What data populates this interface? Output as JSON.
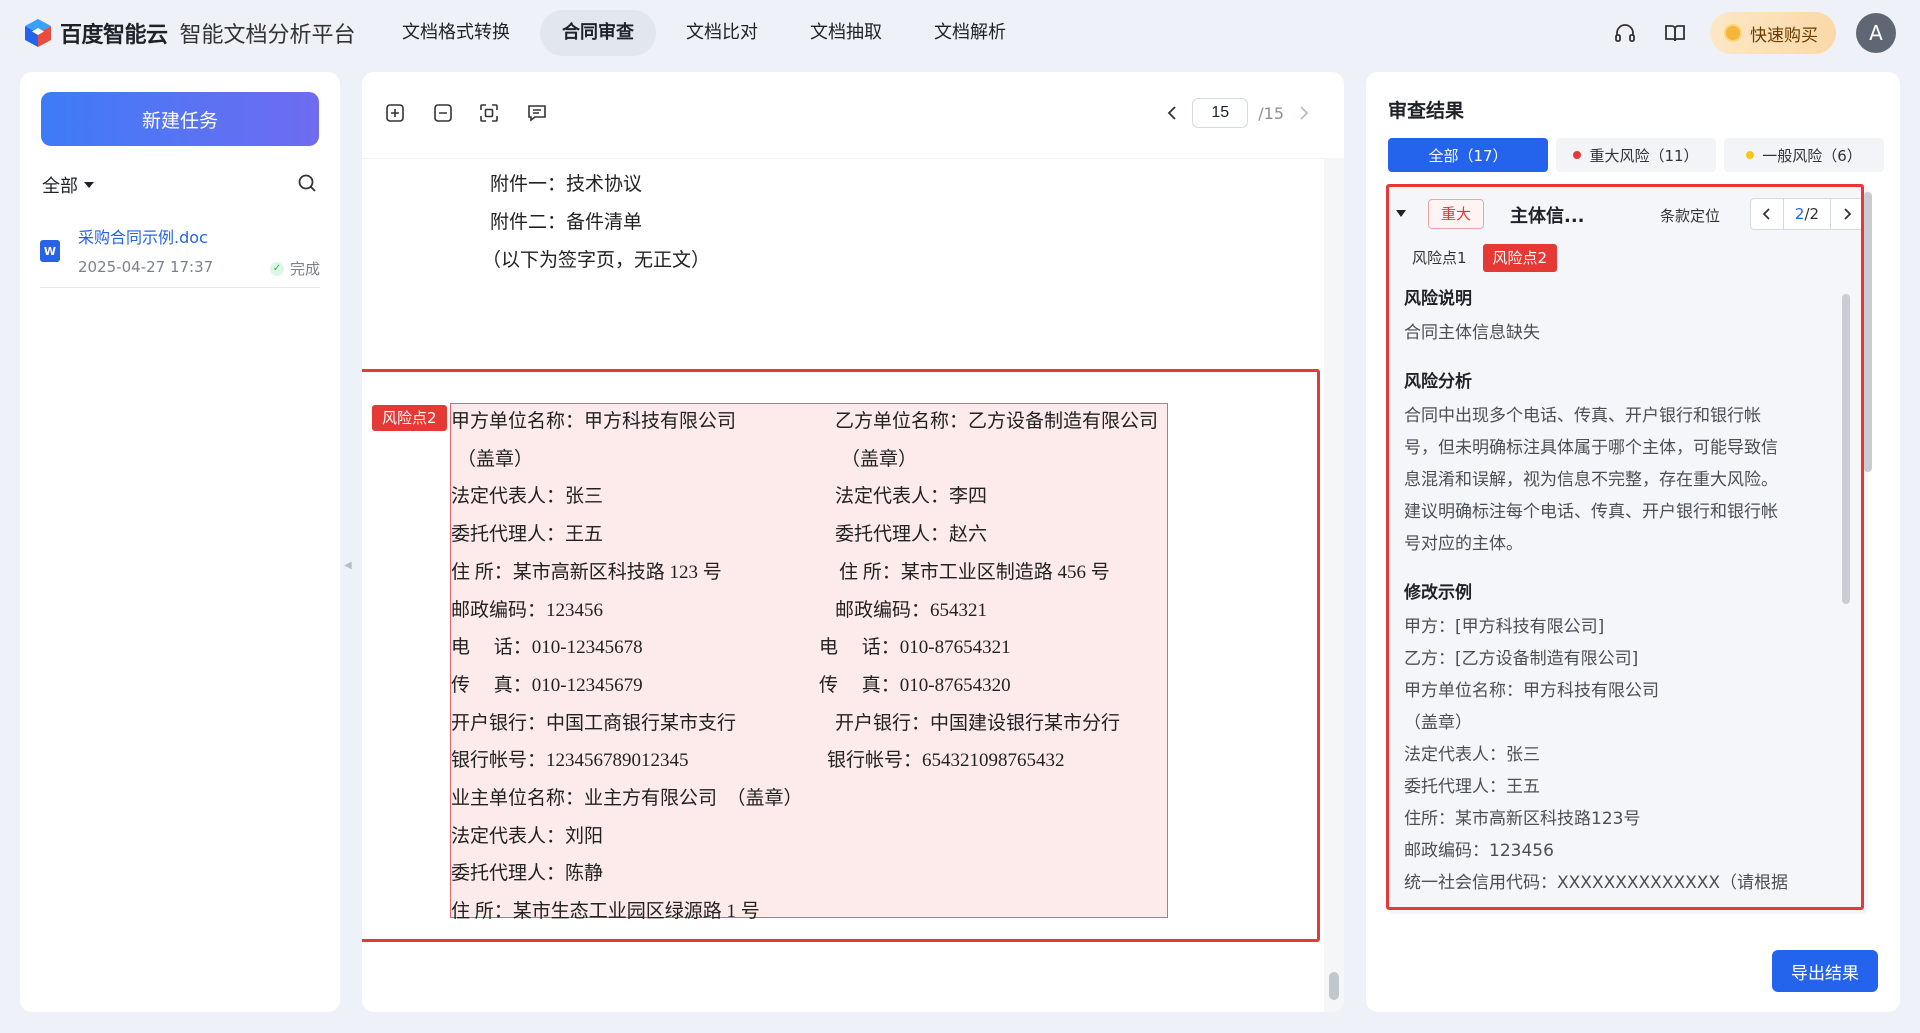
{
  "brand": {
    "company": "百度智能云",
    "product": "智能文档分析平台"
  },
  "nav": [
    {
      "label": "文档格式转换"
    },
    {
      "label": "合同审查"
    },
    {
      "label": "文档比对"
    },
    {
      "label": "文档抽取"
    },
    {
      "label": "文档解析"
    }
  ],
  "topbar": {
    "buy_label": "快速购买",
    "avatar_letter": "A"
  },
  "sidebar": {
    "new_task": "新建任务",
    "filter": "全部",
    "documents": [
      {
        "icon_letter": "W",
        "name": "采购合同示例.doc",
        "date": "2025-04-27 17:37",
        "status": "完成"
      }
    ]
  },
  "viewer": {
    "current_page": "15",
    "total_pages": "/15",
    "lines_before": [
      "附件一：技术协议",
      "附件二：备件清单",
      "（以下为签字页，无正文）"
    ],
    "risk_tag": "风险点2",
    "signature": {
      "left": [
        "甲方单位名称：甲方科技有限公司",
        "（盖章）",
        "法定代表人：张三",
        "委托代理人：王五",
        "住 所：某市高新区科技路 123 号",
        "邮政编码：123456",
        "电　 话：010-12345678",
        "传　 真：010-12345679",
        "开户银行：中国工商银行某市支行",
        "银行帐号：123456789012345",
        "业主单位名称：业主方有限公司　（盖章）",
        "法定代表人：刘阳",
        "委托代理人：陈静",
        "住 所：某市生态工业园区绿源路 1 号"
      ],
      "right": [
        "乙方单位名称：乙方设备制造有限公司",
        "（盖章）",
        "法定代表人：李四",
        "委托代理人：赵六",
        "住 所：某市工业区制造路 456 号",
        "邮政编码：654321",
        "电　 话：010-87654321",
        "传　 真：010-87654320",
        "开户银行：中国建设银行某市分行",
        "银行帐号：654321098765432"
      ]
    }
  },
  "results": {
    "title": "审查结果",
    "tabs": [
      {
        "label": "全部（17）",
        "dot": ""
      },
      {
        "label": "重大风险（11）",
        "dot": "#e53935"
      },
      {
        "label": "一般风险（6）",
        "dot": "#f5c518"
      }
    ],
    "card": {
      "severity": "重大",
      "name": "主体信...",
      "clause_locate": "条款定位",
      "index": "2",
      "total": "/2",
      "points": [
        "风险点1",
        "风险点2"
      ],
      "sections": [
        {
          "title": "风险说明",
          "lines": [
            "合同主体信息缺失"
          ]
        },
        {
          "title": "风险分析",
          "lines": [
            "合同中出现多个电话、传真、开户银行和银行帐",
            "号，但未明确标注具体属于哪个主体，可能导致信",
            "息混淆和误解，视为信息不完整，存在重大风险。",
            "建议明确标注每个电话、传真、开户银行和银行帐",
            "号对应的主体。"
          ]
        },
        {
          "title": "修改示例",
          "lines": [
            "甲方：[甲方科技有限公司]",
            "乙方：[乙方设备制造有限公司]",
            "甲方单位名称：甲方科技有限公司",
            "（盖章）",
            "法定代表人：张三",
            "委托代理人：王五",
            "住所：某市高新区科技路123号",
            "邮政编码：123456",
            "统一社会信用代码：XXXXXXXXXXXXXX（请根据"
          ]
        }
      ]
    },
    "export_label": "导出结果"
  },
  "colors": {
    "accent": "#2463eb",
    "risk": "#e53935",
    "general_risk": "#f5c518"
  }
}
